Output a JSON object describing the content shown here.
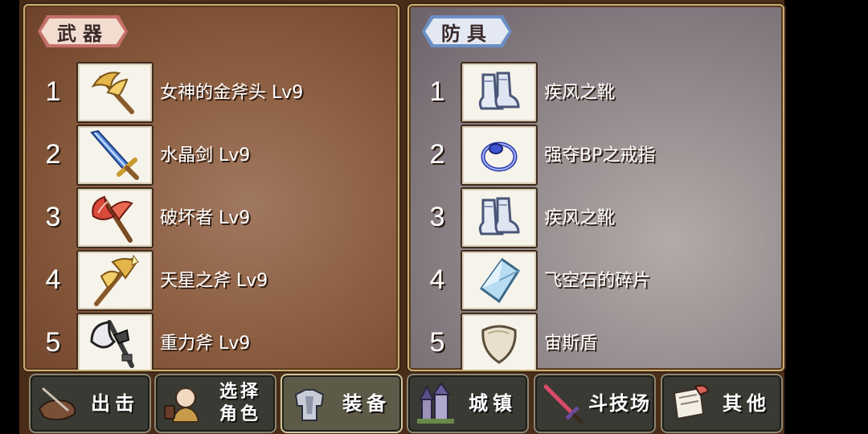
{
  "weapons": {
    "title": "武器",
    "items": [
      {
        "index": "1",
        "name": "女神的金斧头 Lv9",
        "icon": "golden-axe-icon"
      },
      {
        "index": "2",
        "name": "水晶剑 Lv9",
        "icon": "crystal-sword-icon"
      },
      {
        "index": "3",
        "name": "破坏者 Lv9",
        "icon": "destroyer-axe-icon"
      },
      {
        "index": "4",
        "name": "天星之斧 Lv9",
        "icon": "star-halberd-icon"
      },
      {
        "index": "5",
        "name": "重力斧 Lv9",
        "icon": "gravity-axe-icon"
      }
    ]
  },
  "armor": {
    "title": "防具",
    "items": [
      {
        "index": "1",
        "name": "疾风之靴",
        "icon": "boots-icon"
      },
      {
        "index": "2",
        "name": "强夺BP之戒指",
        "icon": "ring-icon"
      },
      {
        "index": "3",
        "name": "疾风之靴",
        "icon": "boots-icon"
      },
      {
        "index": "4",
        "name": "飞空石的碎片",
        "icon": "crystal-shard-icon"
      },
      {
        "index": "5",
        "name": "宙斯盾",
        "icon": "shield-icon"
      }
    ]
  },
  "nav": [
    {
      "label": "出击",
      "icon": "sortie-icon",
      "active": false
    },
    {
      "label_line1": "选择",
      "label_line2": "角色",
      "icon": "character-icon",
      "active": false
    },
    {
      "label": "装备",
      "icon": "armor-icon",
      "active": true
    },
    {
      "label": "城镇",
      "icon": "town-icon",
      "active": false
    },
    {
      "label": "斗技场",
      "icon": "arena-sword-icon",
      "active": false
    },
    {
      "label": "其他",
      "icon": "scroll-icon",
      "active": false
    }
  ],
  "colors": {
    "weapon_panel": "#8d5f42",
    "armor_panel": "#938a8d",
    "weapon_tag": "#c5706a",
    "armor_tag": "#6b8fc4",
    "active_nav_border": "#d2c89a"
  }
}
